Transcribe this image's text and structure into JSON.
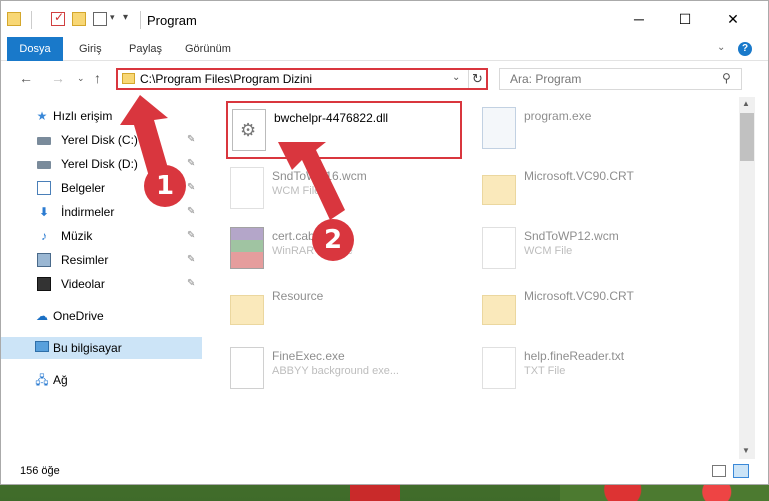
{
  "titlebar": {
    "title": "Program",
    "minimize_glyph": "─",
    "maximize_glyph": "☐",
    "close_glyph": "✕"
  },
  "ribbon": {
    "tabs": [
      "Dosya",
      "Giriş",
      "Paylaş",
      "Görünüm"
    ],
    "help_glyph": "?"
  },
  "navbar": {
    "back_glyph": "←",
    "forward_glyph": "→",
    "recent_glyph": "⌄",
    "up_glyph": "↑",
    "address": "C:\\Program Files\\Program Dizini",
    "address_dropdown_glyph": "⌄",
    "refresh_glyph": "↻",
    "search_placeholder": "Ara: Program",
    "search_glyph": "⚲"
  },
  "sidebar": {
    "items": [
      {
        "label": "Hızlı erişim",
        "icon": "star-icon"
      },
      {
        "label": "Yerel Disk (C:)",
        "icon": "disk-icon"
      },
      {
        "label": "Yerel Disk (D:)",
        "icon": "disk-icon"
      },
      {
        "label": "Belgeler",
        "icon": "document-icon"
      },
      {
        "label": "İndirmeler",
        "icon": "download-icon"
      },
      {
        "label": "Müzik",
        "icon": "music-icon"
      },
      {
        "label": "Resimler",
        "icon": "pictures-icon"
      },
      {
        "label": "Videolar",
        "icon": "video-icon"
      },
      {
        "label": "OneDrive",
        "icon": "cloud-icon"
      },
      {
        "label": "Bu bilgisayar",
        "icon": "computer-icon"
      },
      {
        "label": "Ağ",
        "icon": "network-icon"
      }
    ],
    "pin_glyph": "📌"
  },
  "files": [
    {
      "name": "bwchelpr-4476822.dll",
      "desc": "",
      "icon": "dll-file-icon"
    },
    {
      "name": "program.exe",
      "desc": "",
      "icon": "exe-file-icon"
    },
    {
      "name": "SndToWP16.wcm",
      "desc": "WCM File",
      "icon": "page-file-icon"
    },
    {
      "name": "Microsoft.VC90.CRT",
      "desc": "",
      "icon": "folder-icon"
    },
    {
      "name": "cert.cab",
      "desc": "WinRAR archive",
      "icon": "archive-icon"
    },
    {
      "name": "SndToWP12.wcm",
      "desc": "WCM File",
      "icon": "page-file-icon"
    },
    {
      "name": "Resource",
      "desc": "",
      "icon": "folder-icon"
    },
    {
      "name": "Microsoft.VC90.CRT",
      "desc": "",
      "icon": "folder-icon"
    },
    {
      "name": "FineExec.exe",
      "desc": "ABBYY background exe...",
      "icon": "app-file-icon"
    },
    {
      "name": "help.fineReader.txt",
      "desc": "TXT File",
      "icon": "page-file-icon"
    }
  ],
  "statusbar": {
    "item_count": "156 öğe"
  },
  "annotations": {
    "step1": "1",
    "step2": "2",
    "accent": "#d9363e"
  },
  "colors": {
    "ribbon_active": "#1979ca",
    "selection": "#cce4f7"
  }
}
